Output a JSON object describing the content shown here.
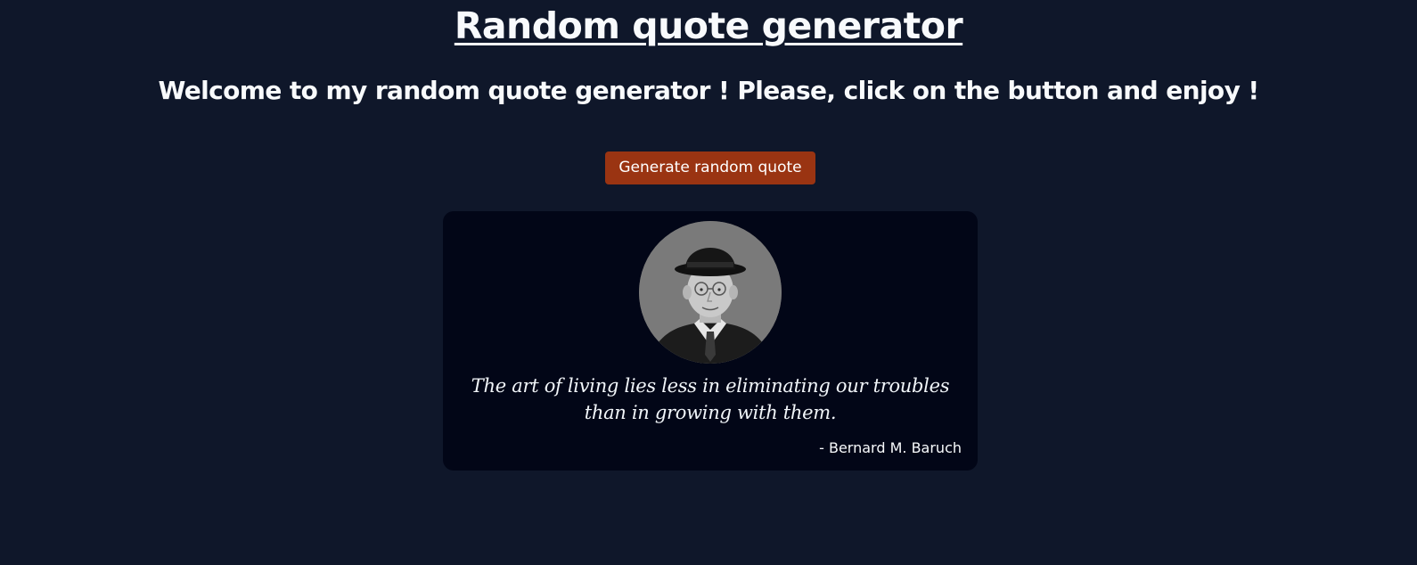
{
  "page": {
    "title": "Random quote generator",
    "welcome": "Welcome to my random quote generator ! Please, click on the button and enjoy !"
  },
  "actions": {
    "generate_label": "Generate random quote"
  },
  "quote": {
    "text": "The art of living lies less in eliminating our troubles than in growing with them.",
    "author": "- Bernard M. Baruch",
    "portrait_icon": "author-portrait"
  },
  "colors": {
    "background": "#0f172a",
    "card": "#020617",
    "button": "#9a3412",
    "text": "#f8fafc"
  }
}
